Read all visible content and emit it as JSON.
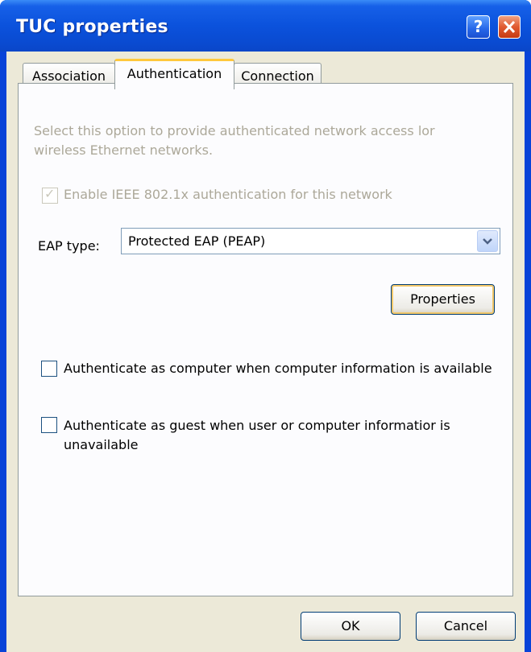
{
  "window": {
    "title": "TUC properties"
  },
  "titlebar": {
    "help_label": "?",
    "close_label": "✕"
  },
  "tabs": [
    {
      "label": "Association",
      "active": false
    },
    {
      "label": "Authentication",
      "active": true
    },
    {
      "label": "Connection",
      "active": false
    }
  ],
  "auth": {
    "description": "Select this option to provide authenticated network access lor wireless Ethernet networks.",
    "enable_8021x": {
      "label": "Enable IEEE 802.1x authentication for this network",
      "checked": true,
      "disabled": true
    },
    "eap_type": {
      "label": "EAP type:",
      "value": "Protected EAP (PEAP)"
    },
    "properties_button": "Properties",
    "auth_as_computer": {
      "label": "Authenticate as computer when computer information is available",
      "checked": false
    },
    "auth_as_guest": {
      "label": "Authenticate as guest when user or computer informatior is unavailable",
      "checked": false
    }
  },
  "footer": {
    "ok_label": "OK",
    "cancel_label": "Cancel"
  }
}
